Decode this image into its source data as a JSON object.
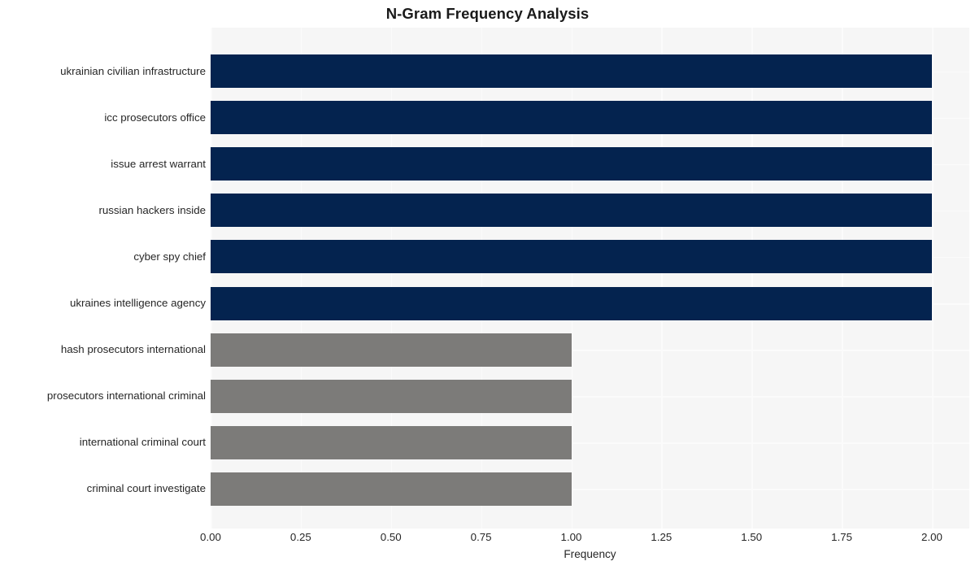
{
  "chart_data": {
    "type": "bar",
    "orientation": "horizontal",
    "title": "N-Gram Frequency Analysis",
    "xlabel": "Frequency",
    "ylabel": "",
    "xlim": [
      0,
      2
    ],
    "grid": true,
    "legend": null,
    "xticks": [
      "0.00",
      "0.25",
      "0.50",
      "0.75",
      "1.00",
      "1.25",
      "1.50",
      "1.75",
      "2.00"
    ],
    "xtick_values": [
      0,
      0.25,
      0.5,
      0.75,
      1.0,
      1.25,
      1.5,
      1.75,
      2.0
    ],
    "categories": [
      "ukrainian civilian infrastructure",
      "icc prosecutors office",
      "issue arrest warrant",
      "russian hackers inside",
      "cyber spy chief",
      "ukraines intelligence agency",
      "hash prosecutors international",
      "prosecutors international criminal",
      "international criminal court",
      "criminal court investigate"
    ],
    "values": [
      2,
      2,
      2,
      2,
      2,
      2,
      1,
      1,
      1,
      1
    ],
    "bar_colors": [
      "#04234f",
      "#04234f",
      "#04234f",
      "#04234f",
      "#04234f",
      "#04234f",
      "#7c7b79",
      "#7c7b79",
      "#7c7b79",
      "#7c7b79"
    ]
  },
  "style": {
    "plot_background": "#f6f6f6",
    "figure_background": "#ffffff",
    "grid_color": "#fbfbfb",
    "text_color": "#262626",
    "title_color": "#1a1a1a",
    "primary_bar_color": "#04234f",
    "secondary_bar_color": "#7c7b79"
  }
}
